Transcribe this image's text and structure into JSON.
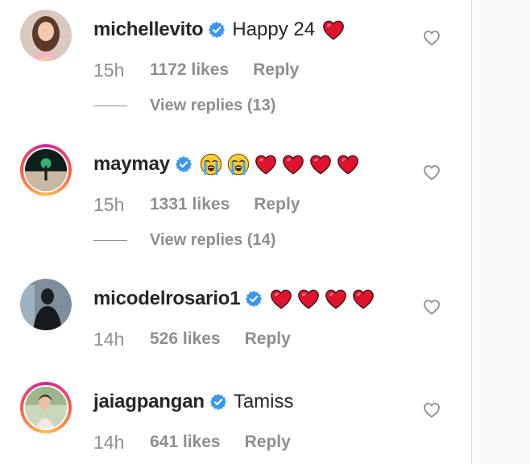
{
  "comments": [
    {
      "username": "michellevito",
      "verified": true,
      "text": "Happy 24",
      "emojis": [
        "red-heart"
      ],
      "time": "15h",
      "likes": "1172 likes",
      "reply_label": "Reply",
      "view_replies": "View replies (13)",
      "has_story_ring": false
    },
    {
      "username": "maymay",
      "verified": true,
      "text": "",
      "emojis": [
        "loudly-crying-face",
        "loudly-crying-face",
        "red-heart",
        "red-heart",
        "red-heart",
        "red-heart"
      ],
      "time": "15h",
      "likes": "1331 likes",
      "reply_label": "Reply",
      "view_replies": "View replies (14)",
      "has_story_ring": true
    },
    {
      "username": "micodelrosario1",
      "verified": true,
      "text": "",
      "emojis": [
        "red-heart",
        "red-heart",
        "red-heart",
        "red-heart"
      ],
      "time": "14h",
      "likes": "526 likes",
      "reply_label": "Reply",
      "view_replies": "",
      "has_story_ring": false
    },
    {
      "username": "jaiagpangan",
      "verified": true,
      "text": "Tamiss",
      "emojis": [],
      "time": "14h",
      "likes": "641 likes",
      "reply_label": "Reply",
      "view_replies": "",
      "has_story_ring": true
    }
  ],
  "colors": {
    "primary_text": "#262626",
    "secondary_text": "#8e8e8e",
    "verified_blue": "#3897f0",
    "heart_red": "#e0132f"
  }
}
